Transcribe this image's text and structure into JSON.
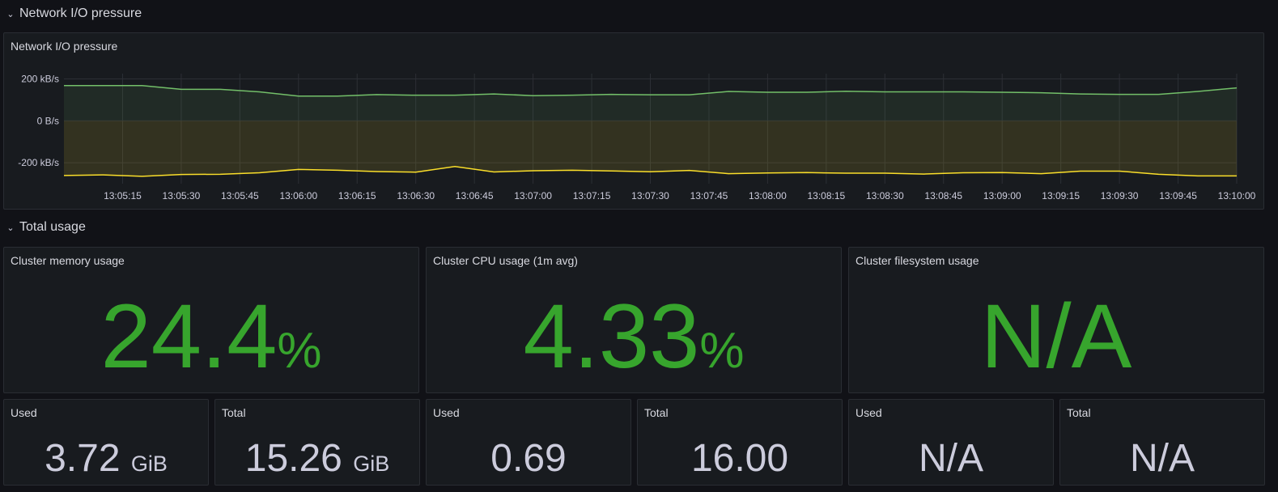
{
  "rows": {
    "network_title": "Network I/O pressure",
    "total_title": "Total usage"
  },
  "network_panel": {
    "title": "Network I/O pressure"
  },
  "stats": [
    {
      "title": "Cluster memory usage",
      "value": "24.4",
      "unit": "%"
    },
    {
      "title": "Cluster CPU usage (1m avg)",
      "value": "4.33",
      "unit": "%"
    },
    {
      "title": "Cluster filesystem usage",
      "value": "N/A",
      "unit": ""
    }
  ],
  "small_stats": [
    {
      "title": "Used",
      "value": "3.72",
      "unit": "GiB"
    },
    {
      "title": "Total",
      "value": "15.26",
      "unit": "GiB"
    },
    {
      "title": "Used",
      "value": "0.69",
      "unit": ""
    },
    {
      "title": "Total",
      "value": "16.00",
      "unit": ""
    },
    {
      "title": "Used",
      "value": "N/A",
      "unit": ""
    },
    {
      "title": "Total",
      "value": "N/A",
      "unit": ""
    }
  ],
  "colors": {
    "stat_green": "#37a52d",
    "receive_line": "#73bf69",
    "transmit_line": "#fade2a"
  },
  "chart_data": {
    "type": "area",
    "title": "Network I/O pressure",
    "y_unit": "B/s",
    "y_tick_labels": [
      "200 kB/s",
      "0 B/s",
      "-200 kB/s"
    ],
    "y_tick_values": [
      200,
      0,
      -200
    ],
    "ylim": [
      -300,
      225
    ],
    "x_tick_labels": [
      "13:05:15",
      "13:05:30",
      "13:05:45",
      "13:06:00",
      "13:06:15",
      "13:06:30",
      "13:06:45",
      "13:07:00",
      "13:07:15",
      "13:07:30",
      "13:07:45",
      "13:08:00",
      "13:08:15",
      "13:08:30",
      "13:08:45",
      "13:09:00",
      "13:09:15",
      "13:09:30",
      "13:09:45",
      "13:10:00"
    ],
    "grid": true,
    "x_seconds_from_13_05_00": [
      0,
      15,
      30,
      45,
      60,
      75,
      90,
      105,
      120,
      135,
      150,
      165,
      180,
      195,
      210,
      225,
      240,
      255,
      270,
      285,
      300
    ],
    "series": [
      {
        "values": [
          168,
          168,
          168,
          150,
          150,
          138,
          118,
          118,
          125,
          122,
          122,
          128,
          120,
          122,
          126,
          124,
          124,
          140,
          136,
          136,
          141,
          138,
          138,
          138,
          136,
          134,
          128,
          126,
          126,
          140,
          157
        ]
      },
      {
        "values": [
          -261,
          -258,
          -265,
          -256,
          -255,
          -248,
          -232,
          -236,
          -242,
          -245,
          -218,
          -244,
          -238,
          -236,
          -239,
          -243,
          -237,
          -252,
          -249,
          -247,
          -250,
          -250,
          -254,
          -248,
          -247,
          -252,
          -240,
          -240,
          -255,
          -263,
          -263
        ]
      }
    ]
  }
}
